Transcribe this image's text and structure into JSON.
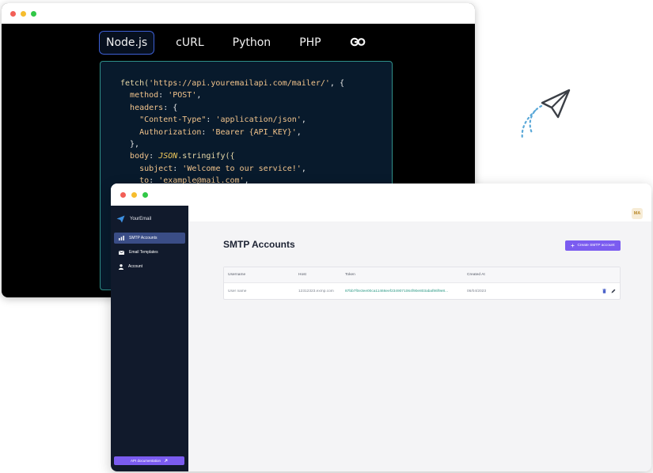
{
  "code_window": {
    "tabs": [
      {
        "label": "Node.js",
        "active": true
      },
      {
        "label": "cURL",
        "active": false
      },
      {
        "label": "Python",
        "active": false
      },
      {
        "label": "PHP",
        "active": false
      },
      {
        "label": "Go",
        "active": false
      }
    ],
    "code": {
      "l1_fn": "fetch(",
      "l1_url": "'https://api.youremailapi.com/mailer/'",
      "l1_end": ", {",
      "l2_key": "method",
      "l2_val": "'POST'",
      "l3_key": "headers",
      "l4_key": "\"Content-Type\"",
      "l4_val": "'application/json'",
      "l5_key": "Authorization",
      "l5_val": "'Bearer {API_KEY}'",
      "l7_key": "body",
      "l7_kw": "JSON",
      "l7_fn": ".stringify({",
      "l8_key": "subject",
      "l8_val": "'Welcome to our service!'",
      "l9_key": "to",
      "l9_val": "'example@mail.com'"
    },
    "colors": {
      "accent_border": "#3d5fd4",
      "code_border": "#2f8f89"
    }
  },
  "dashboard": {
    "brand": "YourEmail",
    "user_initials": "MA",
    "sidebar": {
      "items": [
        {
          "label": "SMTP Accounts",
          "icon": "chart-icon",
          "active": true
        },
        {
          "label": "Email Templates",
          "icon": "envelope-icon",
          "active": false
        },
        {
          "label": "Account",
          "icon": "user-icon",
          "active": false
        }
      ],
      "api_doc_label": "API documentation"
    },
    "page_title": "SMTP Accounts",
    "create_button_label": "Create SMTP account",
    "table": {
      "columns": [
        "Username",
        "Host",
        "Token",
        "Created At"
      ],
      "rows": [
        {
          "username": "User name",
          "host": "12312323.exmp.com",
          "token": "87bb7f0e3ee00ca11466eef2349071064f90e803abaf86f9e8...",
          "created_at": "06/04/2023"
        }
      ]
    },
    "colors": {
      "sidebar_bg": "#111a2c",
      "primary": "#7b5cf0",
      "token_text": "#2d9a86"
    }
  }
}
